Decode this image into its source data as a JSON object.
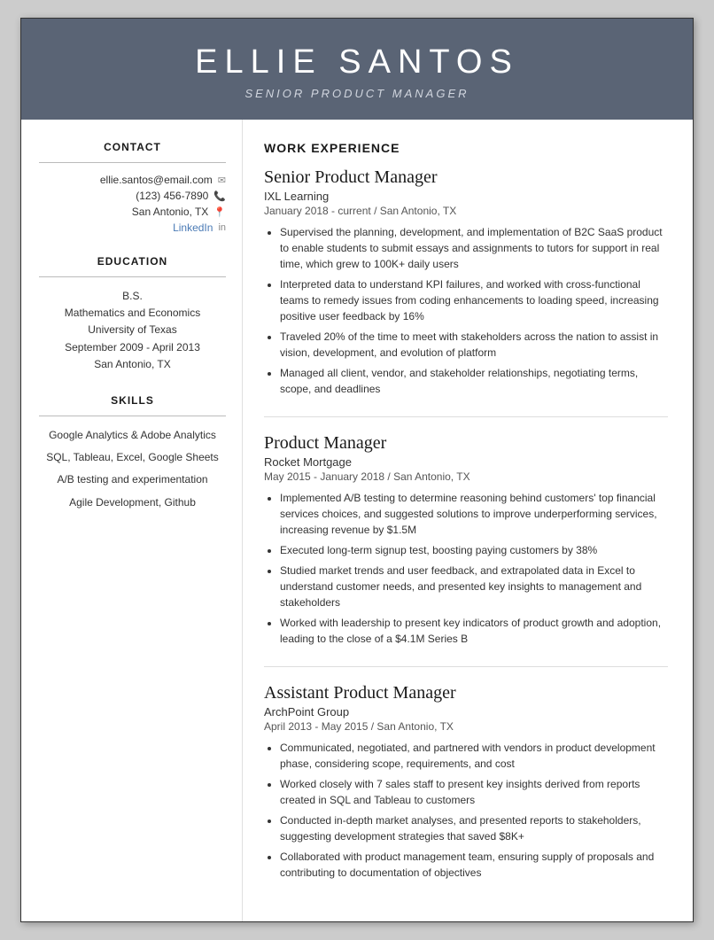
{
  "header": {
    "name": "ELLIE SANTOS",
    "title": "SENIOR PRODUCT MANAGER"
  },
  "sidebar": {
    "contact_title": "CONTACT",
    "education_title": "EDUCATION",
    "skills_title": "SKILLS",
    "contact": {
      "email": "ellie.santos@email.com",
      "phone": "(123) 456-7890",
      "location": "San Antonio, TX",
      "linkedin_label": "LinkedIn"
    },
    "education": {
      "degree": "B.S.",
      "major": "Mathematics and Economics",
      "school": "University of Texas",
      "dates": "September 2009 - April 2013",
      "city": "San Antonio, TX"
    },
    "skills": [
      "Google Analytics & Adobe Analytics",
      "SQL, Tableau, Excel, Google Sheets",
      "A/B testing and experimentation",
      "Agile Development, Github"
    ]
  },
  "main": {
    "work_experience_title": "WORK EXPERIENCE",
    "jobs": [
      {
        "title": "Senior Product Manager",
        "company": "IXL Learning",
        "meta": "January 2018 - current  /  San Antonio, TX",
        "bullets": [
          "Supervised the planning, development, and implementation of B2C SaaS product to enable students to submit essays and assignments to tutors for support in real time, which grew to 100K+ daily users",
          "Interpreted data to understand KPI failures, and worked with cross-functional teams to remedy issues from coding enhancements to loading speed, increasing positive user feedback by 16%",
          "Traveled 20% of the time to meet with stakeholders across the nation to assist in vision, development, and evolution of platform",
          "Managed all client, vendor, and stakeholder relationships, negotiating terms, scope, and deadlines"
        ]
      },
      {
        "title": "Product Manager",
        "company": "Rocket Mortgage",
        "meta": "May 2015 - January 2018  /  San Antonio, TX",
        "bullets": [
          "Implemented A/B testing to determine reasoning behind customers' top financial services choices, and suggested solutions to improve underperforming services, increasing revenue by $1.5M",
          "Executed long-term signup test, boosting paying customers by 38%",
          "Studied market trends and user feedback, and extrapolated data in Excel to understand customer needs, and presented key insights to management and stakeholders",
          "Worked with leadership to present key indicators of product growth and adoption, leading to the close of a $4.1M Series B"
        ]
      },
      {
        "title": "Assistant Product Manager",
        "company": "ArchPoint Group",
        "meta": "April 2013 - May 2015  /  San Antonio, TX",
        "bullets": [
          "Communicated, negotiated, and partnered with vendors in product development phase, considering scope, requirements, and cost",
          "Worked closely with 7 sales staff to present key insights derived from reports created in SQL and Tableau to customers",
          "Conducted in-depth market analyses, and presented reports to stakeholders, suggesting development strategies that saved $8K+",
          "Collaborated with product management team, ensuring supply of proposals and contributing to documentation of objectives"
        ]
      }
    ]
  }
}
